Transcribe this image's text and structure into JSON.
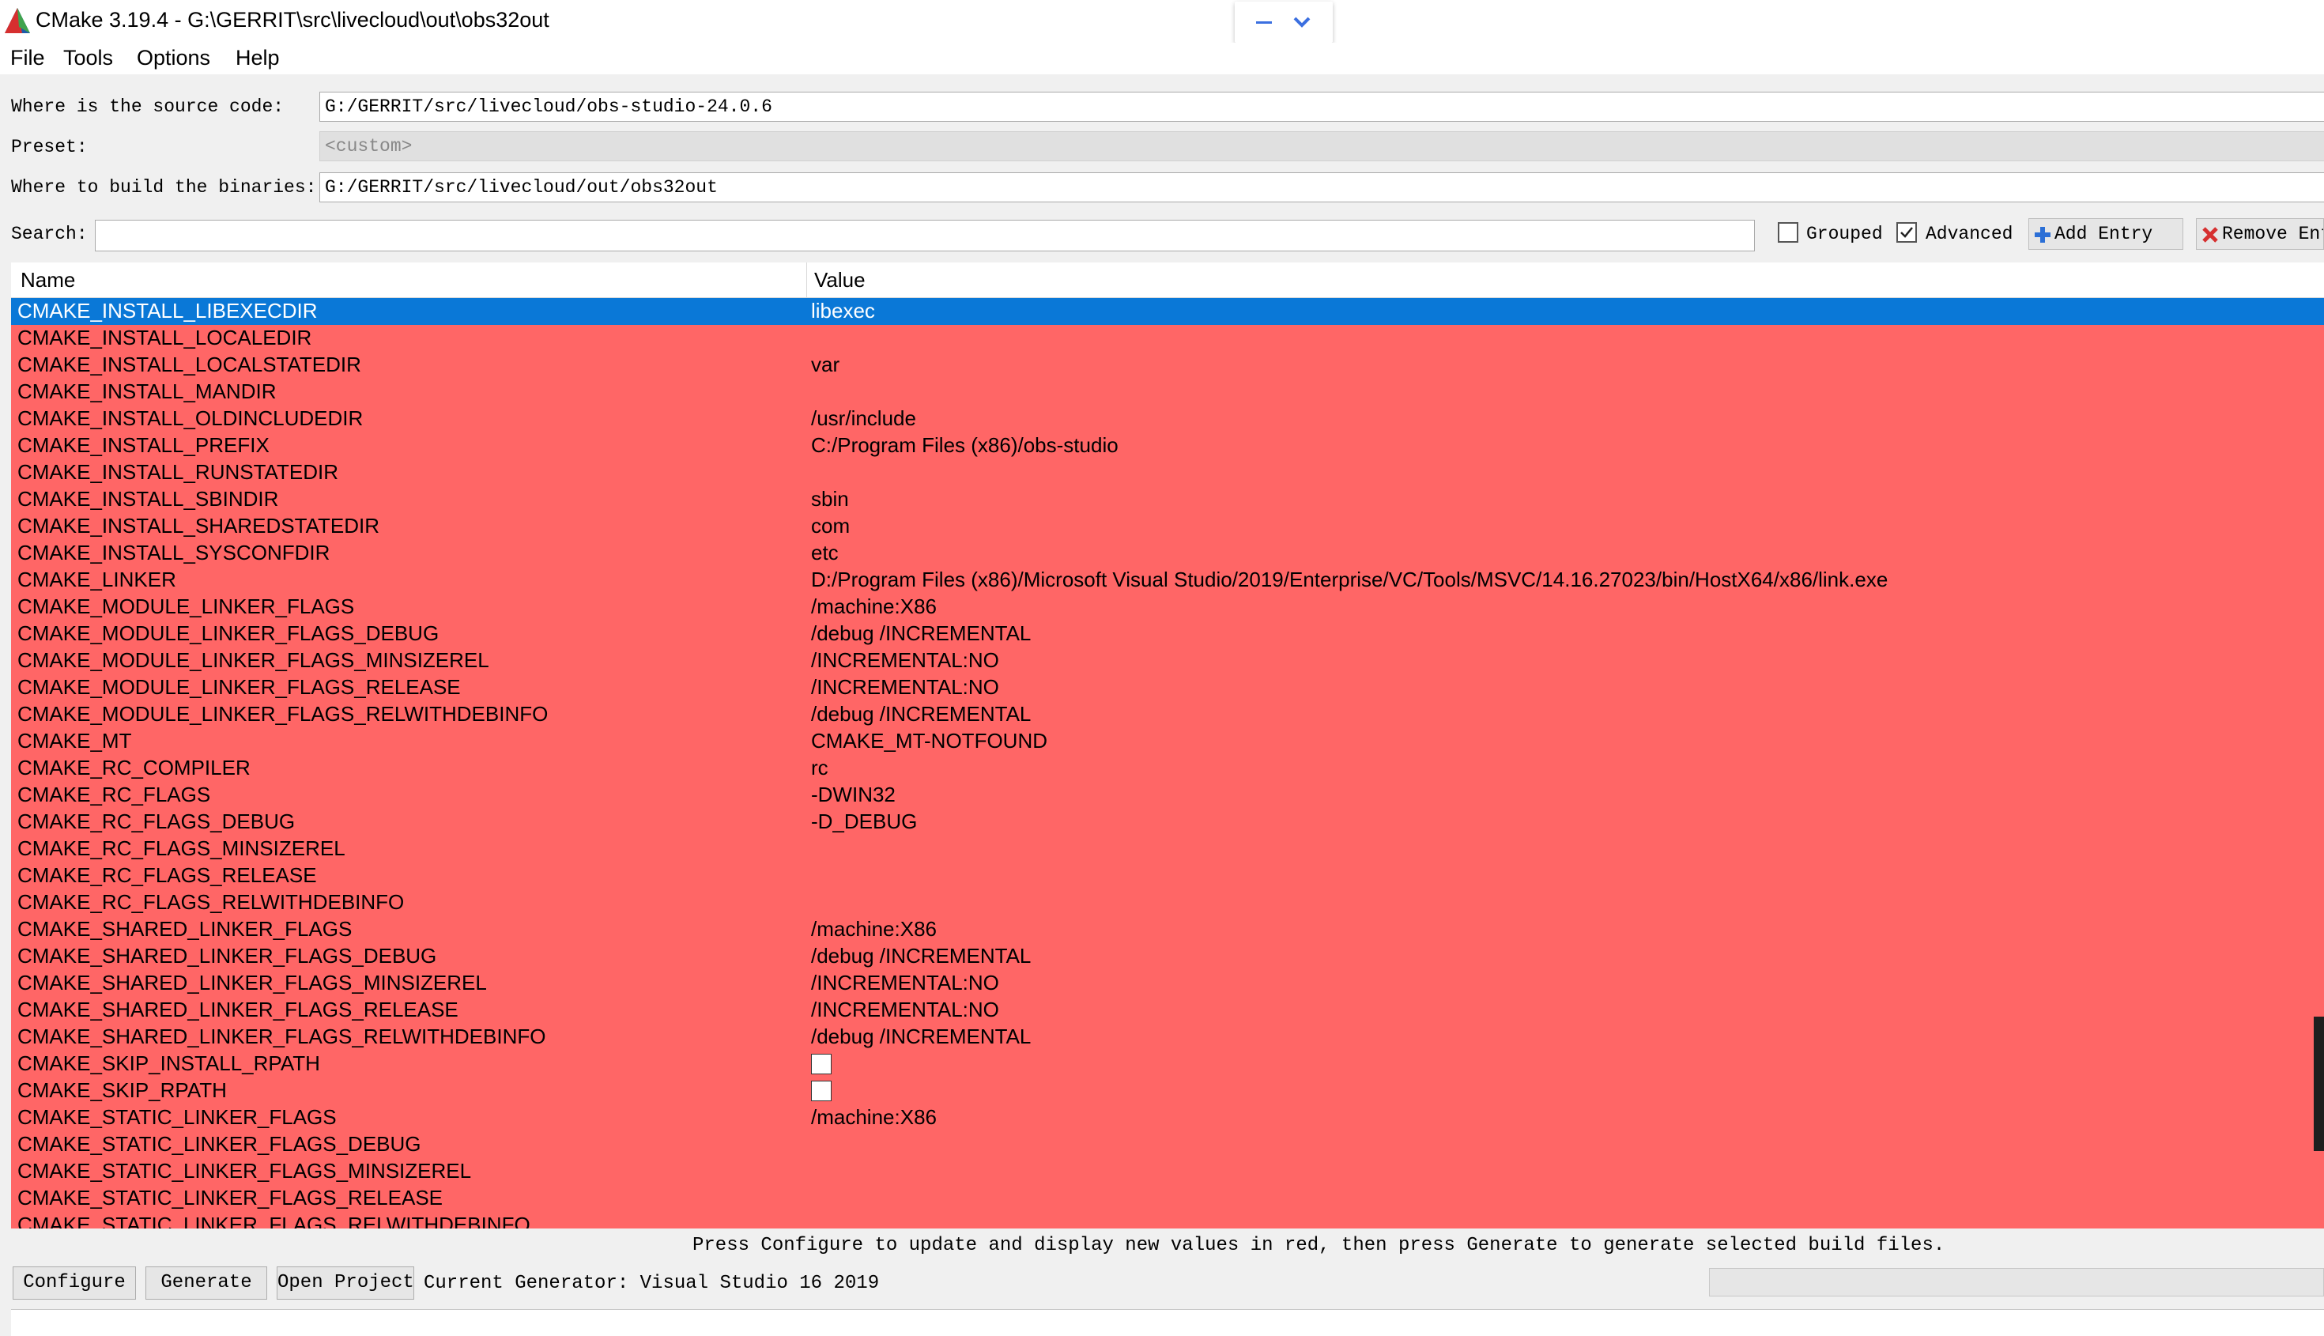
{
  "window": {
    "title": "CMake 3.19.4 - G:\\GERRIT\\src\\livecloud\\out\\obs32out"
  },
  "menu": [
    "File",
    "Tools",
    "Options",
    "Help"
  ],
  "paths": {
    "source_label": "Where is the source code:",
    "source_value": "G:/GERRIT/src/livecloud/obs-studio-24.0.6",
    "preset_label": "Preset:",
    "preset_value": "<custom>",
    "build_label": "Where to build the binaries:",
    "build_value": "G:/GERRIT/src/livecloud/out/obs32out"
  },
  "search": {
    "label": "Search:",
    "value": ""
  },
  "options": {
    "grouped_label": "Grouped",
    "grouped_checked": false,
    "advanced_label": "Advanced",
    "advanced_checked": true,
    "add_entry_label": "Add Entry",
    "remove_entry_label": "Remove Ent"
  },
  "table": {
    "headers": [
      "Name",
      "Value"
    ],
    "rows": [
      {
        "name": "CMAKE_INSTALL_LIBEXECDIR",
        "value": "libexec",
        "selected": true
      },
      {
        "name": "CMAKE_INSTALL_LOCALEDIR",
        "value": ""
      },
      {
        "name": "CMAKE_INSTALL_LOCALSTATEDIR",
        "value": "var"
      },
      {
        "name": "CMAKE_INSTALL_MANDIR",
        "value": ""
      },
      {
        "name": "CMAKE_INSTALL_OLDINCLUDEDIR",
        "value": "/usr/include"
      },
      {
        "name": "CMAKE_INSTALL_PREFIX",
        "value": "C:/Program Files (x86)/obs-studio"
      },
      {
        "name": "CMAKE_INSTALL_RUNSTATEDIR",
        "value": ""
      },
      {
        "name": "CMAKE_INSTALL_SBINDIR",
        "value": "sbin"
      },
      {
        "name": "CMAKE_INSTALL_SHAREDSTATEDIR",
        "value": "com"
      },
      {
        "name": "CMAKE_INSTALL_SYSCONFDIR",
        "value": "etc"
      },
      {
        "name": "CMAKE_LINKER",
        "value": "D:/Program Files (x86)/Microsoft Visual Studio/2019/Enterprise/VC/Tools/MSVC/14.16.27023/bin/HostX64/x86/link.exe"
      },
      {
        "name": "CMAKE_MODULE_LINKER_FLAGS",
        "value": "/machine:X86"
      },
      {
        "name": "CMAKE_MODULE_LINKER_FLAGS_DEBUG",
        "value": "/debug /INCREMENTAL"
      },
      {
        "name": "CMAKE_MODULE_LINKER_FLAGS_MINSIZEREL",
        "value": "/INCREMENTAL:NO"
      },
      {
        "name": "CMAKE_MODULE_LINKER_FLAGS_RELEASE",
        "value": "/INCREMENTAL:NO"
      },
      {
        "name": "CMAKE_MODULE_LINKER_FLAGS_RELWITHDEBINFO",
        "value": "/debug /INCREMENTAL"
      },
      {
        "name": "CMAKE_MT",
        "value": "CMAKE_MT-NOTFOUND"
      },
      {
        "name": "CMAKE_RC_COMPILER",
        "value": "rc"
      },
      {
        "name": "CMAKE_RC_FLAGS",
        "value": "-DWIN32"
      },
      {
        "name": "CMAKE_RC_FLAGS_DEBUG",
        "value": "-D_DEBUG"
      },
      {
        "name": "CMAKE_RC_FLAGS_MINSIZEREL",
        "value": ""
      },
      {
        "name": "CMAKE_RC_FLAGS_RELEASE",
        "value": ""
      },
      {
        "name": "CMAKE_RC_FLAGS_RELWITHDEBINFO",
        "value": ""
      },
      {
        "name": "CMAKE_SHARED_LINKER_FLAGS",
        "value": "/machine:X86"
      },
      {
        "name": "CMAKE_SHARED_LINKER_FLAGS_DEBUG",
        "value": "/debug /INCREMENTAL"
      },
      {
        "name": "CMAKE_SHARED_LINKER_FLAGS_MINSIZEREL",
        "value": "/INCREMENTAL:NO"
      },
      {
        "name": "CMAKE_SHARED_LINKER_FLAGS_RELEASE",
        "value": "/INCREMENTAL:NO"
      },
      {
        "name": "CMAKE_SHARED_LINKER_FLAGS_RELWITHDEBINFO",
        "value": "/debug /INCREMENTAL"
      },
      {
        "name": "CMAKE_SKIP_INSTALL_RPATH",
        "value": "",
        "checkbox": true,
        "checked": false
      },
      {
        "name": "CMAKE_SKIP_RPATH",
        "value": "",
        "checkbox": true,
        "checked": false
      },
      {
        "name": "CMAKE_STATIC_LINKER_FLAGS",
        "value": "/machine:X86"
      },
      {
        "name": "CMAKE_STATIC_LINKER_FLAGS_DEBUG",
        "value": ""
      },
      {
        "name": "CMAKE_STATIC_LINKER_FLAGS_MINSIZEREL",
        "value": ""
      },
      {
        "name": "CMAKE_STATIC_LINKER_FLAGS_RELEASE",
        "value": ""
      },
      {
        "name": "CMAKE_STATIC_LINKER_FLAGS_RELWITHDEBINFO",
        "value": ""
      }
    ]
  },
  "status": {
    "message": "Press Configure to update and display new values in red, then press Generate to generate selected build files."
  },
  "buttons": {
    "configure": "Configure",
    "generate": "Generate",
    "open_project": "Open Project"
  },
  "generator": {
    "text": "Current Generator: Visual Studio 16 2019"
  },
  "colors": {
    "new_entry_red": "#ff6666",
    "selection_blue": "#0a78d7",
    "window_bg": "#f0f0f0"
  },
  "icons": {
    "app": "cmake-logo",
    "add": "plus-icon",
    "remove": "x-icon",
    "minimize": "minimize-icon",
    "expand": "chevron-down-icon"
  }
}
